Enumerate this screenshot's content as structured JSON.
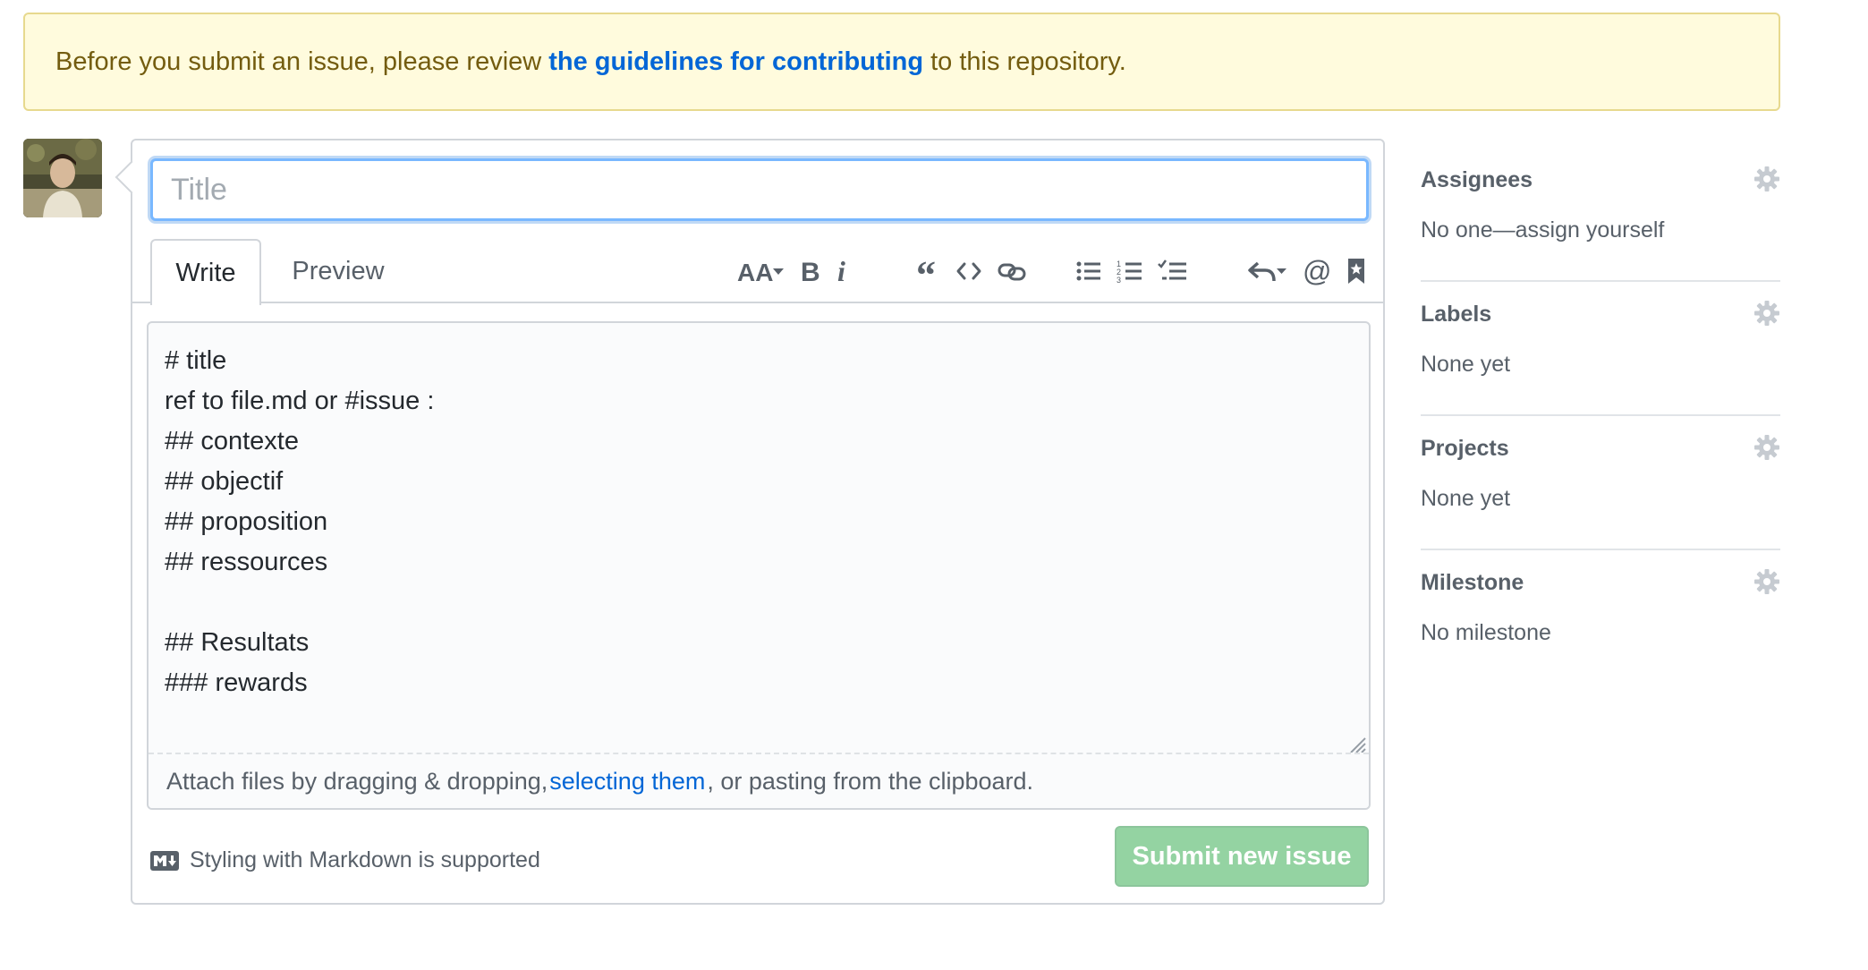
{
  "flash": {
    "before": "Before you submit an issue, please review",
    "link": "the guidelines for contributing",
    "after": "to this repository."
  },
  "form": {
    "title_placeholder": "Title",
    "tabs": [
      {
        "label": "Write"
      },
      {
        "label": "Preview"
      }
    ],
    "toolbar": {
      "icons": [
        "text-size-icon",
        "bold-icon",
        "italic-icon",
        "quote-icon",
        "code-icon",
        "link-icon",
        "unordered-list-icon",
        "ordered-list-icon",
        "task-list-icon",
        "reply-icon",
        "mention-icon",
        "bookmark-icon"
      ]
    },
    "body": "# title\nref to file.md or #issue :\n## contexte\n## objectif\n## proposition\n## ressources\n\n## Resultats\n### rewards",
    "drop": {
      "before": "Attach files by dragging & dropping,",
      "link": "selecting them",
      "after": ", or pasting from the clipboard."
    },
    "markdown_hint": "Styling with Markdown is supported",
    "submit_label": "Submit new issue",
    "submit_color": "#94d3a2"
  },
  "sidebar": {
    "assignees": {
      "heading": "Assignees",
      "value": "No one—assign yourself"
    },
    "labels": {
      "heading": "Labels",
      "value": "None yet"
    },
    "projects": {
      "heading": "Projects",
      "value": "None yet"
    },
    "milestone": {
      "heading": "Milestone",
      "value": "No milestone"
    }
  },
  "colors": {
    "link": "#0366d6",
    "flash_bg": "#fffbdd",
    "focus_border": "#79b8ff"
  }
}
